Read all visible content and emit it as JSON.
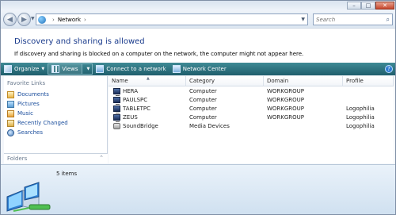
{
  "window": {
    "controls": {
      "minimize": "–",
      "maximize": "□",
      "close": "✕"
    }
  },
  "address": {
    "breadcrumb": [
      "Network"
    ],
    "separator": "›",
    "search_placeholder": "Search"
  },
  "info": {
    "title": "Discovery and sharing is allowed",
    "subtitle": "If discovery and sharing is blocked on a computer on the network, the computer might not appear here."
  },
  "toolbar": {
    "organize": "Organize",
    "views": "Views",
    "connect": "Connect to a network",
    "network_center": "Network Center",
    "help": "?"
  },
  "nav": {
    "heading": "Favorite Links",
    "items": [
      {
        "label": "Documents",
        "icon": "documents-icon"
      },
      {
        "label": "Pictures",
        "icon": "pictures-icon"
      },
      {
        "label": "Music",
        "icon": "music-icon"
      },
      {
        "label": "Recently Changed",
        "icon": "recent-icon"
      },
      {
        "label": "Searches",
        "icon": "searches-icon"
      }
    ],
    "folders_label": "Folders",
    "folders_chevron": "⌃"
  },
  "table": {
    "columns": [
      "Name",
      "Category",
      "Domain",
      "Profile"
    ],
    "rows": [
      {
        "name": "HERA",
        "category": "Computer",
        "domain": "WORKGROUP",
        "profile": "",
        "icon": "computer-icon"
      },
      {
        "name": "PAULSPC",
        "category": "Computer",
        "domain": "WORKGROUP",
        "profile": "",
        "icon": "computer-icon"
      },
      {
        "name": "TABLETPC",
        "category": "Computer",
        "domain": "WORKGROUP",
        "profile": "Logophilia",
        "icon": "computer-icon"
      },
      {
        "name": "ZEUS",
        "category": "Computer",
        "domain": "WORKGROUP",
        "profile": "Logophilia",
        "icon": "computer-icon"
      },
      {
        "name": "SoundBridge",
        "category": "Media Devices",
        "domain": "",
        "profile": "Logophilia",
        "icon": "media-device-icon"
      }
    ]
  },
  "details": {
    "count": "5 items"
  },
  "colors": {
    "toolbar": "#2b6e7a",
    "info_title": "#1a3b8c",
    "link": "#1a4d9c"
  }
}
